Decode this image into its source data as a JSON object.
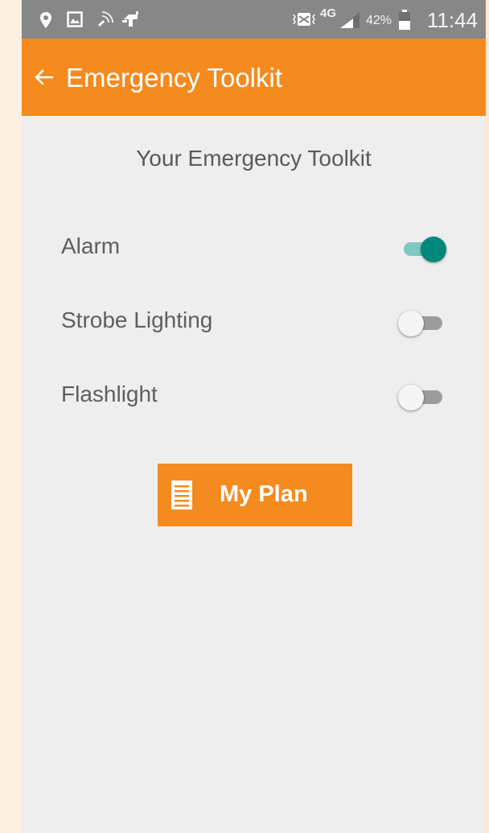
{
  "status_bar": {
    "icons": [
      "location-pin-icon",
      "image-icon",
      "nfc-icon",
      "android-debug-icon",
      "vibrate-icon",
      "signal-icon",
      "battery-icon"
    ],
    "network": "4G",
    "battery": "42%",
    "time": "11:44"
  },
  "app_bar": {
    "back_icon": "arrow-left-icon",
    "title": "Emergency Toolkit",
    "color": "#f58a1f"
  },
  "main": {
    "heading": "Your Emergency Toolkit",
    "toggles": [
      {
        "label": "Alarm",
        "on": true
      },
      {
        "label": "Strobe Lighting",
        "on": false
      },
      {
        "label": "Flashlight",
        "on": false
      }
    ],
    "plan_button": {
      "icon": "document-icon",
      "label": "My Plan"
    }
  },
  "colors": {
    "accent": "#f58a1f",
    "toggle_on": "#00897b",
    "background": "#eeeeee"
  }
}
